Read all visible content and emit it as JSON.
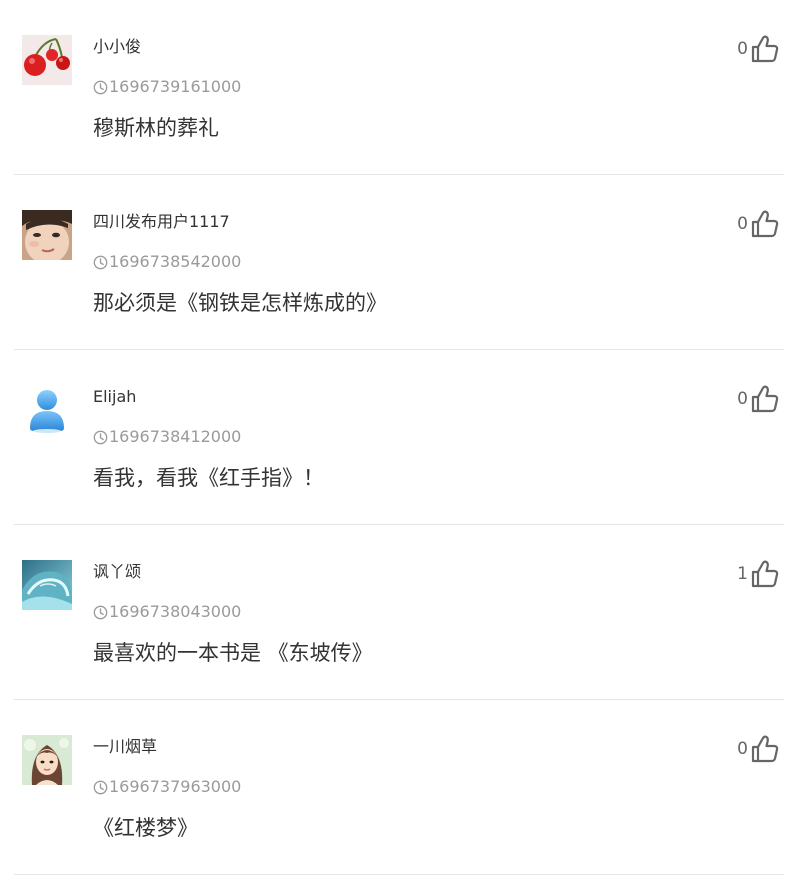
{
  "comments": [
    {
      "username": "小小俊",
      "time": "1696739161000",
      "content": "穆斯林的葬礼",
      "likes": "0",
      "avatar": "cherries-avatar"
    },
    {
      "username": "四川发布用户1117",
      "time": "1696738542000",
      "content": "那必须是《钢铁是怎样炼成的》",
      "likes": "0",
      "avatar": "child-face-avatar"
    },
    {
      "username": "Elijah",
      "time": "1696738412000",
      "content": "看我，看我《红手指》！",
      "likes": "0",
      "avatar": "default-user-avatar"
    },
    {
      "username": "讽丫颂",
      "time": "1696738043000",
      "content": "最喜欢的一本书是 《东坡传》",
      "likes": "1",
      "avatar": "ocean-wave-avatar"
    },
    {
      "username": "一川烟草",
      "time": "1696737963000",
      "content": "《红楼梦》",
      "likes": "0",
      "avatar": "girl-illustration-avatar"
    }
  ],
  "icons": {
    "time": "clock-icon",
    "like": "thumbs-up-icon"
  },
  "colors": {
    "username": "#333333",
    "time": "#9a9a9a",
    "content": "#333333",
    "like_icon": "#666666",
    "divider": "#e6e6e6",
    "default_avatar_blue": "#3d9fe6"
  }
}
